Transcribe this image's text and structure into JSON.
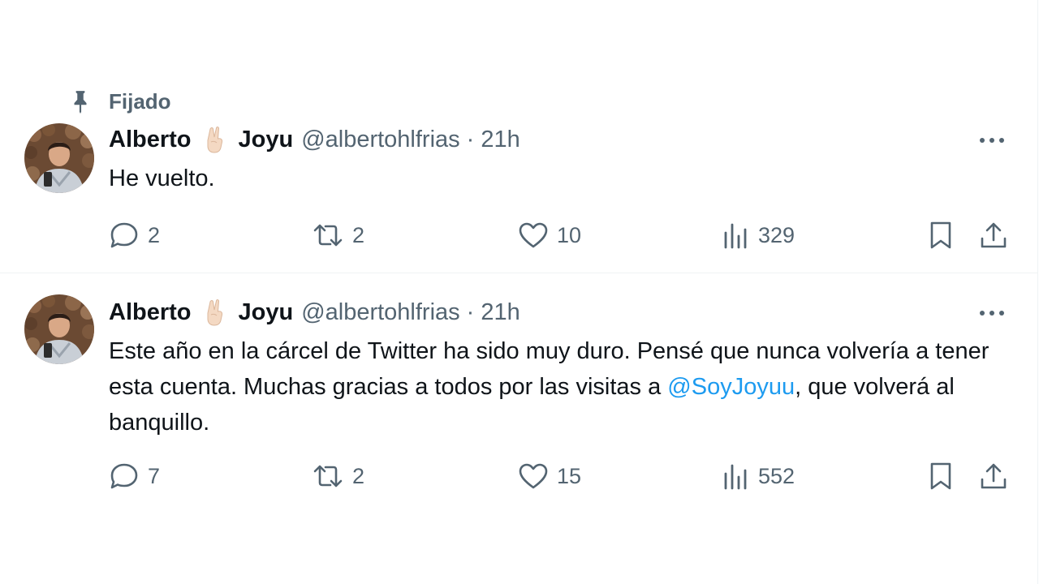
{
  "pinned": {
    "label": "Fijado",
    "icon": "pin-icon"
  },
  "tweets": [
    {
      "author": {
        "name_first": "Alberto",
        "emoji": "✌🏻",
        "name_last": "Joyu",
        "handle": "@albertohlfrias"
      },
      "separator": "·",
      "time": "21h",
      "text": "He vuelto.",
      "text_parts": [],
      "mention": "",
      "counts": {
        "replies": "2",
        "reposts": "2",
        "likes": "10",
        "views": "329"
      }
    },
    {
      "author": {
        "name_first": "Alberto",
        "emoji": "✌🏻",
        "name_last": "Joyu",
        "handle": "@albertohlfrias"
      },
      "separator": "·",
      "time": "21h",
      "text_before": "Este año en la cárcel de Twitter ha sido muy duro. Pensé que nunca volvería a tener esta cuenta. Muchas gracias a todos por las visitas a ",
      "mention": "@SoyJoyuu",
      "text_after": ", que volverá al banquillo.",
      "counts": {
        "replies": "7",
        "reposts": "2",
        "likes": "15",
        "views": "552"
      }
    }
  ],
  "colors": {
    "text": "#0f1419",
    "muted": "#536471",
    "link": "#1d9bf0",
    "divider": "#eff3f4"
  },
  "icons": [
    "pin-icon",
    "reply-icon",
    "repost-icon",
    "like-icon",
    "views-icon",
    "bookmark-icon",
    "share-icon",
    "more-icon",
    "victory-hand-emoji"
  ]
}
